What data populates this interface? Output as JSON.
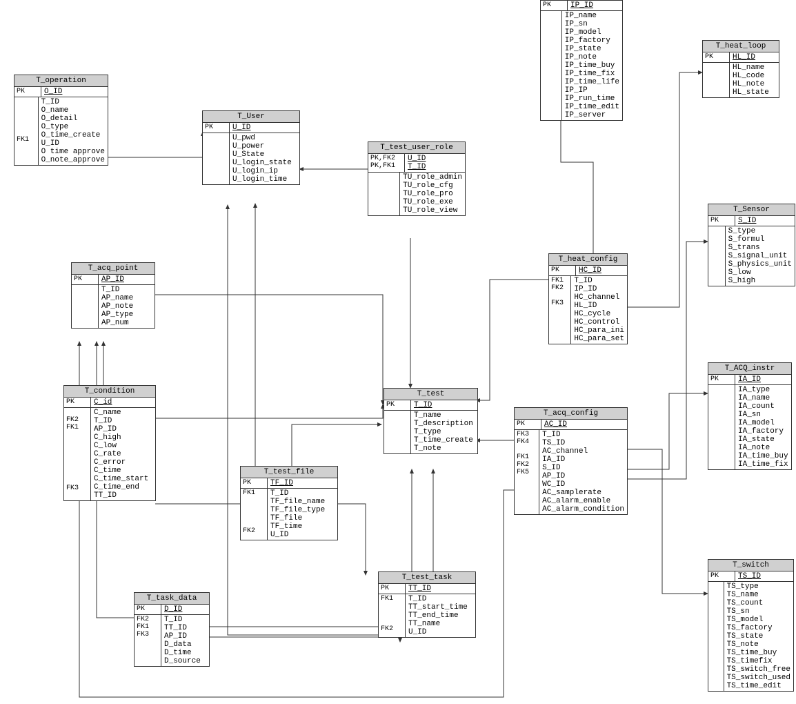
{
  "entities": {
    "operation": {
      "title": "T_operation",
      "pk_keys": "PK",
      "pk_field": "O_ID",
      "fk_keys": "\n\n\n\n\nFK1",
      "attrs": "T_ID\nO_name\nO_detail\nO_type\nO_time_create\nU_ID\nO time approve\nO_note_approve"
    },
    "user": {
      "title": "T_User",
      "pk_keys": "PK",
      "pk_field": "U_ID",
      "fk_keys": "",
      "attrs": "U_pwd\nU_power\nU_State\nU_login_state\nU_login_ip\nU_login_time"
    },
    "test_user_role": {
      "title": "T_test_user_role",
      "pk_keys": "PK,FK2\nPK,FK1",
      "pk_field": "U_ID\nT_ID",
      "fk_keys": "",
      "attrs": "TU_role_admin\nTU_role_cfg\nTU_role_pro\nTU_role_exe\nTU_role_view"
    },
    "acq_point": {
      "title": "T_acq_point",
      "pk_keys": "PK",
      "pk_field": "AP_ID",
      "fk_keys": "",
      "attrs": "T_ID\nAP_name\nAP_note\nAP_type\nAP_num"
    },
    "condition": {
      "title": "T_condition",
      "pk_keys": "PK",
      "pk_field": "C_id",
      "fk_keys": "\nFK2\nFK1\n\n\n\n\n\n\n\nFK3",
      "attrs": "C_name\nT_ID\nAP_ID\nC_high\nC_low\nC_rate\nC_error\nC_time\nC_time_start\nC_time_end\nTT_ID"
    },
    "test_file": {
      "title": "T_test_file",
      "pk_keys": "PK",
      "pk_field": "TF_ID",
      "fk_keys": "FK1\n\n\n\n\nFK2",
      "attrs": "T_ID\nTF_file_name\nTF_file_type\nTF_file\nTF_time\nU_ID"
    },
    "task_data": {
      "title": "T_task_data",
      "pk_keys": "PK",
      "pk_field": "D_ID",
      "fk_keys": "FK2\nFK1\nFK3",
      "attrs": "T_ID\nTT_ID\nAP_ID\nD_data\nD_time\nD_source"
    },
    "test": {
      "title": "T_test",
      "pk_keys": "PK",
      "pk_field": "T_ID",
      "fk_keys": "",
      "attrs": "T_name\nT_description\nT_type\nT_time_create\nT_note"
    },
    "test_task": {
      "title": "T_test_task",
      "pk_keys": "PK",
      "pk_field": "TT_ID",
      "fk_keys": "FK1\n\n\n\nFK2",
      "attrs": "T_ID\nTT_start_time\nTT_end_time\nTT_name\nU_ID"
    },
    "ip": {
      "title": "",
      "pk_keys": "PK",
      "pk_field": "IP_ID",
      "fk_keys": "",
      "attrs": "IP_name\nIP_sn\nIP_model\nIP_factory\nIP_state\nIP_note\nIP_time_buy\nIP_time_fix\nIP_time_life\nIP_IP\nIP_run_time\nIP_time_edit\nIP_server"
    },
    "heat_loop": {
      "title": "T_heat_loop",
      "pk_keys": "PK",
      "pk_field": "HL_ID",
      "fk_keys": "",
      "attrs": "HL_name\nHL_code\nHL_note\nHL_state"
    },
    "sensor": {
      "title": "T_Sensor",
      "pk_keys": "PK",
      "pk_field": "S_ID",
      "fk_keys": "",
      "attrs": "S_type\nS_formul\nS_trans\nS_signal_unit\nS_physics_unit\nS_low\nS_high"
    },
    "heat_config": {
      "title": "T_heat_config",
      "pk_keys": "PK",
      "pk_field": "HC_ID",
      "fk_keys": "FK1\nFK2\n\nFK3",
      "attrs": "T_ID\nIP_ID\nHC_channel\nHL_ID\nHC_cycle\nHC_control\nHC_para_ini\nHC_para_set"
    },
    "acq_config": {
      "title": "T_acq_config",
      "pk_keys": "PK",
      "pk_field": "AC_ID",
      "fk_keys": "FK3\nFK4\n\nFK1\nFK2\nFK5",
      "attrs": "T_ID\nTS_ID\nAC_channel\nIA_ID\nS_ID\nAP_ID\nWC_ID\nAC_samplerate\nAC_alarm_enable\nAC_alarm_condition"
    },
    "acq_instr": {
      "title": "T_ACQ_instr",
      "pk_keys": "PK",
      "pk_field": "IA_ID",
      "fk_keys": "",
      "attrs": "IA_type\nIA_name\nIA_count\nIA_sn\nIA_model\nIA_factory\nIA_state\nIA_note\nIA_time_buy\nIA_time_fix"
    },
    "switch": {
      "title": "T_switch",
      "pk_keys": "PK",
      "pk_field": "TS_ID",
      "fk_keys": "",
      "attrs": "TS_type\nTS_name\nTS_count\nTS_sn\nTS_model\nTS_factory\nTS_state\nTS_note\nTS_time_buy\nTS_timefix\nTS_switch_free\nTS_switch_used\nTS_time_edit"
    }
  }
}
